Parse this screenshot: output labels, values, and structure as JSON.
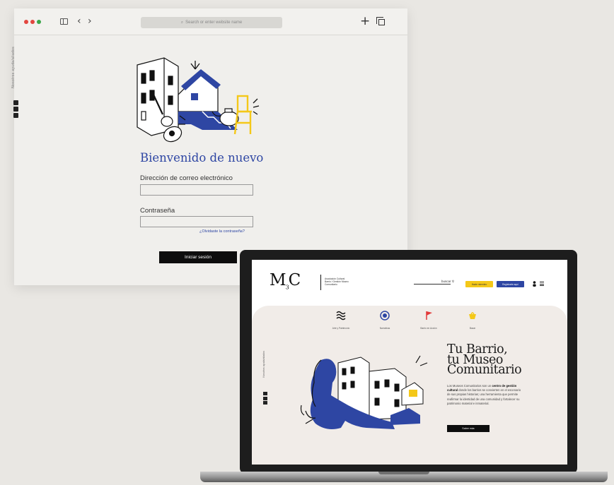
{
  "browser": {
    "url_placeholder": "Search or enter website name",
    "sidebar_vertical": "Nosotros ayuda/aliados",
    "login": {
      "heading": "Bienvenido de nuevo",
      "email_label": "Dirección de correo electrónico",
      "password_label": "Contraseña",
      "forgot_link": "¿Olvidaste la contraseña?",
      "submit_label": "Iniciar sesión"
    }
  },
  "laptop_site": {
    "logo": "M",
    "logo_sub": "C",
    "logo_text": "Asociación Cultural Barrio / Gestión Museo Comunitario",
    "search_label": "buscar",
    "btn_yellow": "Hazte miembro",
    "btn_blue": "Registrarte aquí",
    "categories": [
      {
        "label": "Arte y Patrimonio"
      },
      {
        "label": "Narrativas"
      },
      {
        "label": "Barrio en Acción"
      },
      {
        "label": "Bazar"
      }
    ],
    "sidebar_vertical": "Nosotros ayuda/aliados",
    "hero_title": [
      "Tu Barrio,",
      "tu Museo",
      "Comunitario"
    ],
    "hero_body_pre": "Los Museos Comunitarios son un",
    "hero_body_bold": "centro de gestión cultural",
    "hero_body_post": "donde los barrios se convierten en el escenario de sus propias historias; una herramienta que permite reafirmar la identidad de una comunidad y fortalecer su patrimonio material e inmaterial.",
    "hero_cta": "Saber más"
  },
  "colors": {
    "accent_blue": "#2e46a3",
    "accent_yellow": "#f4c819",
    "accent_red": "#e23a3a"
  }
}
